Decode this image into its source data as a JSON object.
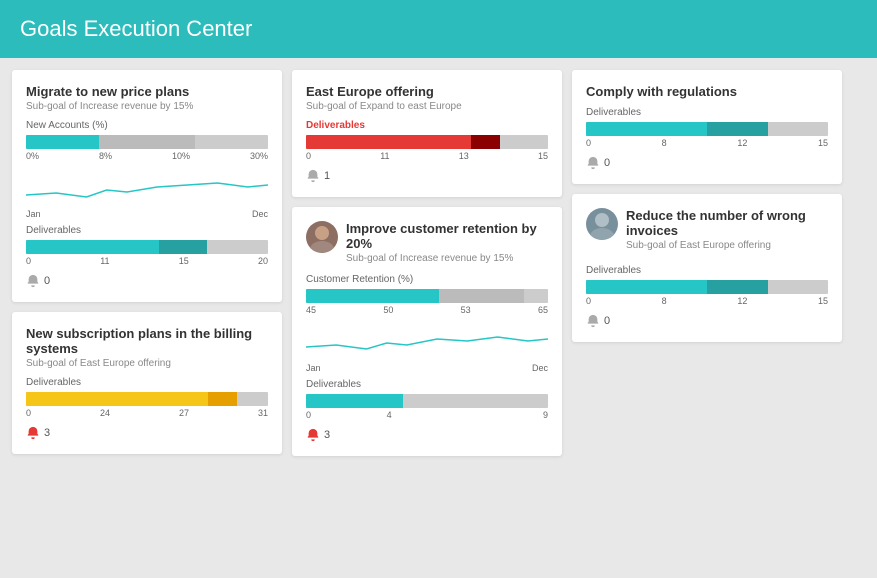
{
  "header": {
    "title": "Goals Execution Center"
  },
  "cards": {
    "card1": {
      "title": "Migrate to new price plans",
      "subtitle": "Sub-goal of Increase revenue by 15%",
      "metric_label": "New Accounts (%)",
      "metric_labels": [
        "0%",
        "8%",
        "10%",
        "30%"
      ],
      "chart_labels": [
        "Jan",
        "Dec"
      ],
      "deliverables_label": "Deliverables",
      "deliverables_scale": [
        "0",
        "11",
        "15",
        "20"
      ],
      "badge_count": "0"
    },
    "card2": {
      "title": "New subscription plans in the billing systems",
      "subtitle": "Sub-goal of East Europe offering",
      "deliverables_label": "Deliverables",
      "deliverables_scale": [
        "0",
        "24",
        "27",
        "31"
      ],
      "badge_count": "3"
    },
    "card3": {
      "title": "East Europe offering",
      "subtitle": "Sub-goal of Expand to east Europe",
      "deliverables_label": "Deliverables",
      "deliverables_scale": [
        "0",
        "11",
        "13",
        "15"
      ],
      "badge_count": "1"
    },
    "card4": {
      "title": "Improve customer retention by 20%",
      "subtitle": "Sub-goal of Increase revenue by 15%",
      "metric_label": "Customer Retention (%)",
      "metric_labels": [
        "45",
        "50",
        "53",
        "65"
      ],
      "chart_labels": [
        "Jan",
        "Dec"
      ],
      "deliverables_label": "Deliverables",
      "deliverables_scale": [
        "0",
        "4",
        "",
        "9"
      ],
      "badge_count": "3"
    },
    "card5": {
      "title": "Comply with regulations",
      "subtitle": "",
      "deliverables_label": "Deliverables",
      "deliverables_scale": [
        "0",
        "8",
        "12",
        "15"
      ],
      "badge_count": "0"
    },
    "card6": {
      "title": "Reduce the number of wrong invoices",
      "subtitle": "Sub-goal of East Europe offering",
      "deliverables_label": "Deliverables",
      "deliverables_scale": [
        "0",
        "8",
        "12",
        "15"
      ],
      "badge_count": "0"
    }
  }
}
